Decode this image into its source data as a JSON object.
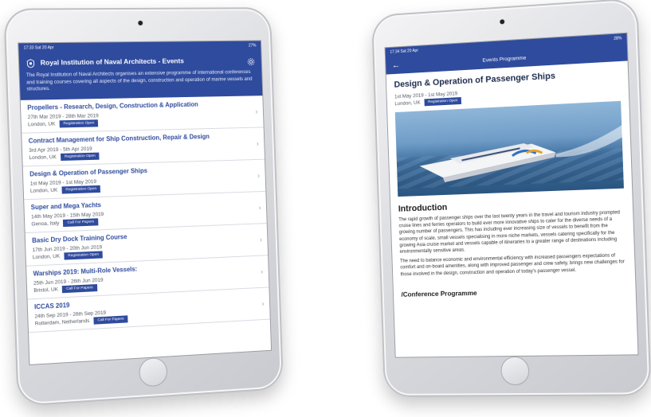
{
  "left": {
    "status": {
      "time": "17:33  Sat 20 Apr",
      "battery": "27%"
    },
    "header": {
      "title": "Royal Institution of Naval Architects - Events",
      "description": "The Royal Institution of Naval Architects organises an extensive programme of international conferences and training courses covering all aspects of the design, construction and operation of marine vessels and structures."
    },
    "events": [
      {
        "title": "Propellers - Research, Design, Construction & Application",
        "dates": "27th Mar 2019  - 28th Mar 2019",
        "location": "London, UK",
        "badge": "Registration Open"
      },
      {
        "title": "Contract Management for Ship Construction, Repair & Design",
        "dates": "3rd Apr 2019  - 5th Apr 2019",
        "location": "London, UK",
        "badge": "Registration Open"
      },
      {
        "title": "Design & Operation of Passenger Ships",
        "dates": "1st May 2019  - 1st May 2019",
        "location": "London, UK",
        "badge": "Registration Open"
      },
      {
        "title": "Super and Mega Yachts",
        "dates": "14th May 2019  - 15th May 2019",
        "location": "Genoa, Italy",
        "badge": "Call For Papers"
      },
      {
        "title": "Basic Dry Dock Training Course",
        "dates": "17th Jun 2019  - 20th Jun 2019",
        "location": "London, UK",
        "badge": "Registration Open"
      },
      {
        "title": "Warships 2019:  Multi-Role Vessels:",
        "dates": "25th Jun 2019  - 26th Jun 2019",
        "location": "Bristol, UK",
        "badge": "Call For Papers"
      },
      {
        "title": "ICCAS 2019",
        "dates": "24th Sep 2019  - 26th Sep 2019",
        "location": "Rotterdam, Netherlands",
        "badge": "Call For Papers"
      }
    ]
  },
  "right": {
    "status": {
      "time": "17:34  Sat 20 Apr",
      "battery": "28%"
    },
    "nav": {
      "back": "←",
      "title": "Events Programme"
    },
    "detail": {
      "title": "Design & Operation of Passenger Ships",
      "dates": "1st May 2019  - 1st May 2019",
      "location": "London, UK",
      "badge": "Registration Open",
      "intro_heading": "Introduction",
      "para1": "The rapid growth of passenger ships over the last twenty years in the travel and tourism industry prompted cruise lines and ferries operators to build ever more innovative ships to cater for the diverse needs of a growing number of passengers. This has including ever increasing size of vessels to benefit from the economy of scale, small vessels specialising in more niche markets, vessels catering specifically for the growing Asia cruise market and vessels capable of itineraries to a greater range of destinations including environmentally sensitive areas.",
      "para2": "The need to balance economic and environmental efficiency with increased passengers expectations of comfort and on-board amenities, along with improved passenger and crew safety, brings new challenges for those involved in the design, construction and operation of today's passenger vessel.",
      "programme_heading": "/Conference Programme"
    }
  },
  "colors": {
    "brand": "#2f4b9e"
  }
}
